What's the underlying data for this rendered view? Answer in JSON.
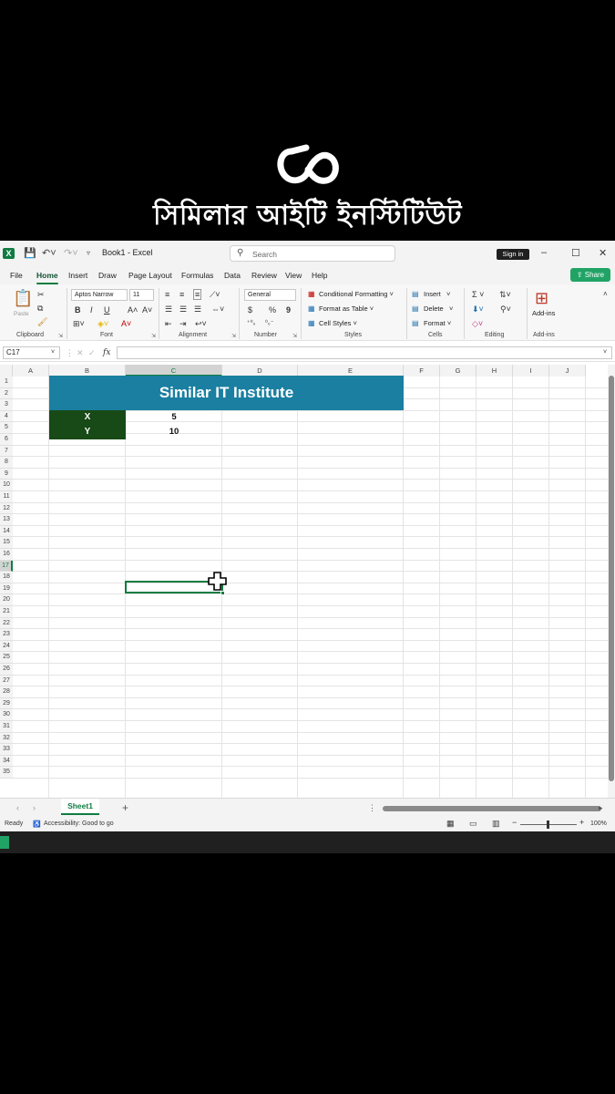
{
  "brand": {
    "name": "সিমিলার আইটি ইনস্টিটিউট",
    "logo": "infinity-s-logo"
  },
  "window": {
    "title": "Book1 - Excel",
    "search_placeholder": "Search",
    "signin_label": "Sign in",
    "controls": [
      "–",
      "☐",
      "✕"
    ]
  },
  "menu": {
    "items": [
      "File",
      "Home",
      "Insert",
      "Draw",
      "Page Layout",
      "Formulas",
      "Data",
      "Review",
      "View",
      "Help"
    ],
    "active": "Home",
    "share_label": "Share"
  },
  "ribbon": {
    "clipboard": {
      "label": "Clipboard",
      "paste": "Paste"
    },
    "font": {
      "label": "Font",
      "name": "Aptos Narrow",
      "size": "11",
      "bold": "B",
      "italic": "I",
      "underline": "U",
      "grow": "A˄",
      "shrink": "A˅"
    },
    "alignment": {
      "label": "Alignment"
    },
    "number": {
      "label": "Number",
      "format": "General",
      "currency": "$",
      "percent": "%",
      "comma": "9"
    },
    "styles": {
      "label": "Styles",
      "conditional": "Conditional Formatting",
      "table": "Format as Table",
      "cell_styles": "Cell Styles"
    },
    "cells": {
      "label": "Cells",
      "insert": "Insert",
      "delete": "Delete",
      "format": "Format"
    },
    "editing": {
      "label": "Editing"
    },
    "addins": {
      "label": "Add-ins",
      "button": "Add-ins"
    }
  },
  "formula_bar": {
    "name_box": "C17",
    "fx": "fx",
    "value": ""
  },
  "columns": [
    "A",
    "B",
    "C",
    "D",
    "E",
    "F",
    "G",
    "H",
    "I",
    "J"
  ],
  "rows": [
    "1",
    "2",
    "3",
    "4",
    "5",
    "6",
    "7",
    "8",
    "9",
    "10",
    "11",
    "12",
    "13",
    "14",
    "15",
    "16",
    "17",
    "18",
    "19",
    "20",
    "21",
    "22",
    "23",
    "24",
    "25",
    "26",
    "27",
    "28",
    "29",
    "30",
    "31",
    "32",
    "33",
    "34",
    "35"
  ],
  "selected_cell": {
    "column": "C",
    "row": "17"
  },
  "sheet_content": {
    "title": "Similar IT Institute",
    "labels": [
      "X",
      "Y"
    ],
    "values": [
      "5",
      "10"
    ],
    "title_color": "#1a7fa1",
    "label_color": "#174a16"
  },
  "sheets": {
    "tabs": [
      "Sheet1"
    ],
    "add": "+"
  },
  "status": {
    "ready": "Ready",
    "accessibility": "Accessibility: Good to go",
    "zoom": "100%"
  }
}
